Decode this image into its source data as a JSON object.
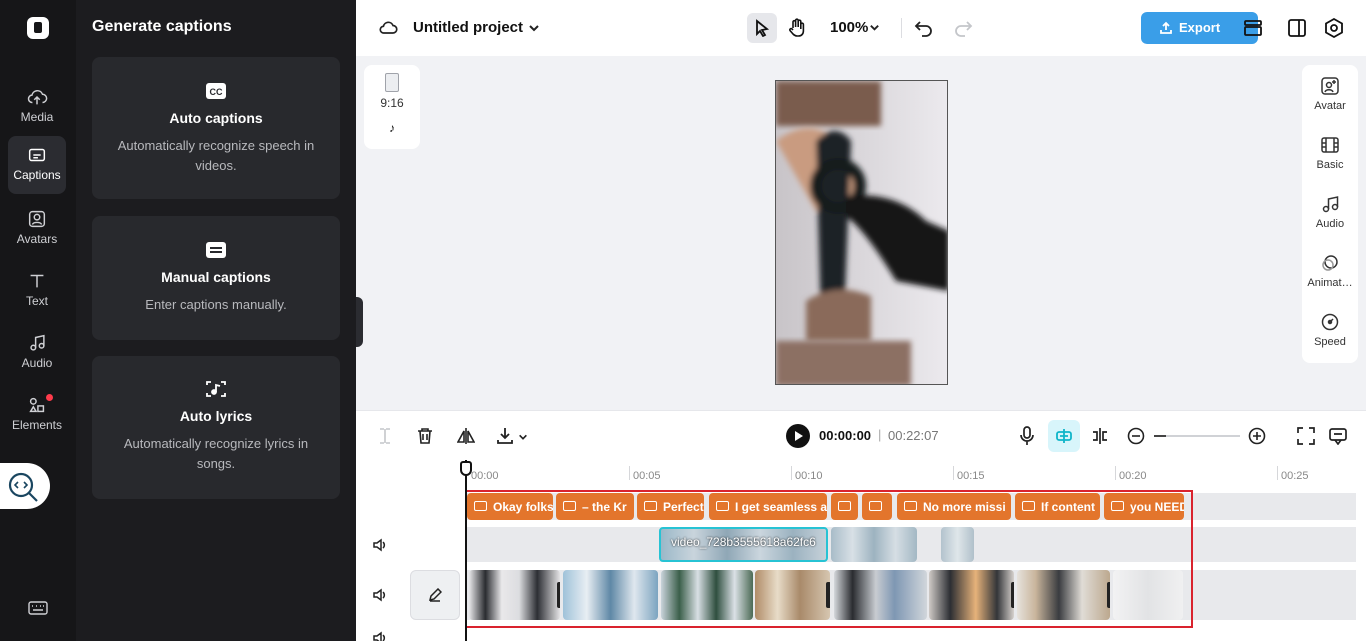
{
  "rail": {
    "items": [
      {
        "label": "Media"
      },
      {
        "label": "Captions"
      },
      {
        "label": "Avatars"
      },
      {
        "label": "Text"
      },
      {
        "label": "Audio"
      },
      {
        "label": "Elements"
      }
    ]
  },
  "panel": {
    "title": "Generate captions",
    "cards": [
      {
        "title": "Auto captions",
        "desc": "Automatically recognize speech in videos."
      },
      {
        "title": "Manual captions",
        "desc": "Enter captions manually."
      },
      {
        "title": "Auto lyrics",
        "desc": "Automatically recognize lyrics in songs."
      }
    ]
  },
  "topbar": {
    "project_title": "Untitled project",
    "zoom": "100%",
    "export_label": "Export"
  },
  "canvas": {
    "ratio": "9:16"
  },
  "right_rail": {
    "items": [
      {
        "label": "Avatar"
      },
      {
        "label": "Basic"
      },
      {
        "label": "Audio"
      },
      {
        "label": "Animat…"
      },
      {
        "label": "Speed"
      }
    ]
  },
  "player": {
    "current_time": "00:00:00",
    "separator": "|",
    "total_time": "00:22:07"
  },
  "timeline": {
    "ruler": [
      "00:00",
      "00:05",
      "00:10",
      "00:15",
      "00:20",
      "00:25"
    ],
    "captions": [
      "Okay folks",
      "– the Kr",
      "Perfect",
      "I get seamless a",
      "",
      "",
      "No more missi",
      "If content",
      "you NEED"
    ],
    "video_clip_label": "video_728b3555618a62fc6"
  },
  "colors": {
    "accent": "#3a9ee8",
    "caption": "#e3752c",
    "selection": "#d9232e",
    "clip_select": "#27c3d4"
  }
}
